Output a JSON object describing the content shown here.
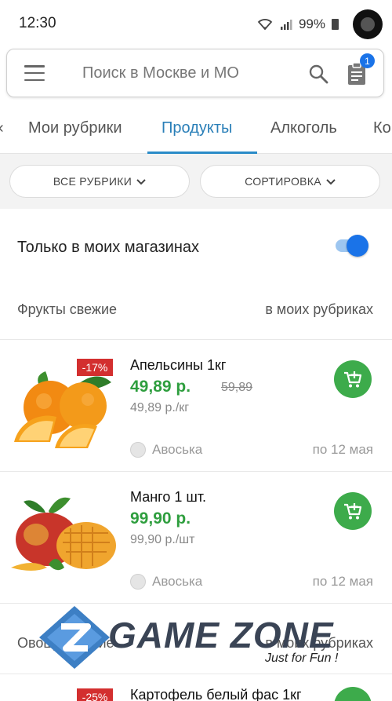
{
  "status": {
    "time": "12:30",
    "battery": "99%"
  },
  "search": {
    "placeholder": "Поиск в Москве и МО",
    "cart_badge": "1"
  },
  "tabs": [
    {
      "label": "‹"
    },
    {
      "label": "Мои рубрики"
    },
    {
      "label": "Продукты"
    },
    {
      "label": "Алкоголь"
    },
    {
      "label": "Ко"
    }
  ],
  "filters": {
    "all_rubrics": "ВСЕ РУБРИКИ",
    "sorting": "СОРТИРОВКА"
  },
  "toggle": {
    "label": "Только в моих магазинах",
    "on": true
  },
  "sections": [
    {
      "title": "Фрукты свежие",
      "link": "в моих рубриках"
    },
    {
      "title": "Овощи свежие",
      "link": "в моих рубриках"
    }
  ],
  "products": [
    {
      "name": "Апельсины 1кг",
      "price": "49,89 р.",
      "old_price": "59,89",
      "unit_price": "49,89 р./кг",
      "discount": "-17%",
      "store": "Авоська",
      "date": "по 12 мая",
      "image": "oranges"
    },
    {
      "name": "Манго 1 шт.",
      "price": "99,90 р.",
      "old_price": "",
      "unit_price": "99,90 р./шт",
      "discount": "",
      "store": "Авоська",
      "date": "по 12 мая",
      "image": "mango"
    },
    {
      "name": "Картофель белый фас 1кг",
      "discount": "-25%"
    }
  ],
  "watermark": {
    "title": "GAME ZONE",
    "subtitle": "Just for Fun !"
  },
  "colors": {
    "accent": "#2a7fb8",
    "price_green": "#2e9e3e",
    "discount_red": "#d32f2f",
    "cart_green": "#3dab4b",
    "toggle_blue": "#1a73e8"
  }
}
